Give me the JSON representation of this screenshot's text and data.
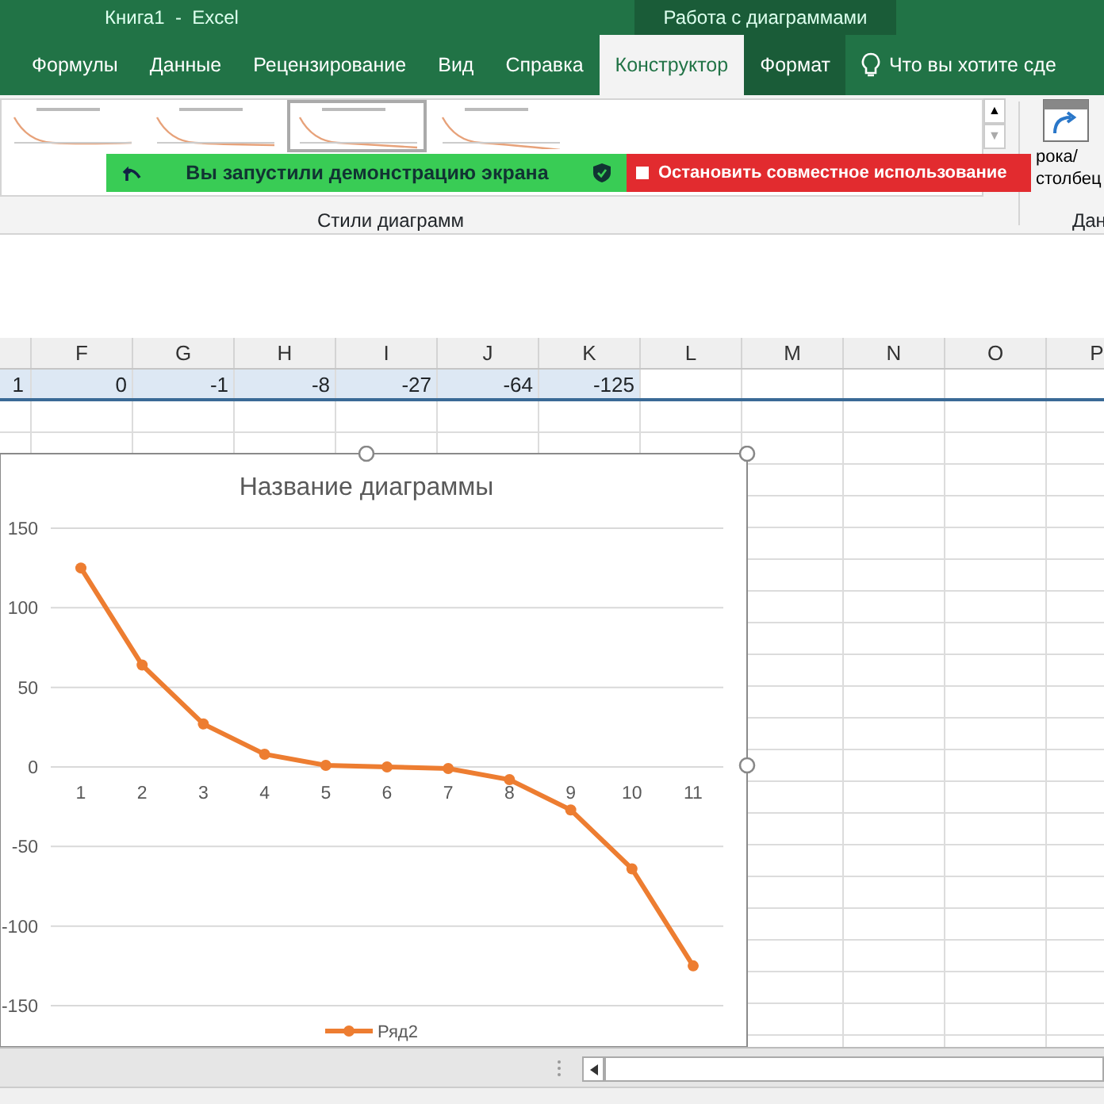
{
  "window": {
    "title": "Книга1  -  Excel",
    "context_title": "Работа с диаграммами"
  },
  "tabs": [
    {
      "label": "Формулы",
      "selected": false,
      "contextual": false
    },
    {
      "label": "Данные",
      "selected": false,
      "contextual": false
    },
    {
      "label": "Рецензирование",
      "selected": false,
      "contextual": false
    },
    {
      "label": "Вид",
      "selected": false,
      "contextual": false
    },
    {
      "label": "Справка",
      "selected": false,
      "contextual": false
    },
    {
      "label": "Конструктор",
      "selected": true,
      "contextual": true
    },
    {
      "label": "Формат",
      "selected": false,
      "contextual": true
    }
  ],
  "tell_me": {
    "placeholder": "Что вы хотите сде"
  },
  "ribbon": {
    "chart_styles": [
      {
        "selected": false
      },
      {
        "selected": false
      },
      {
        "selected": true
      },
      {
        "selected": false
      }
    ],
    "gallery_up": "▲",
    "gallery_down": "▼",
    "group_label": "Стили диаграмм",
    "switch_button_lines": [
      "рока/",
      "столбец"
    ],
    "data_group_label": "Дан"
  },
  "share_banner": {
    "status": "Вы запустили демонстрацию экрана",
    "stop": "Остановить совместное использование"
  },
  "sheet": {
    "columns": [
      "",
      "F",
      "G",
      "H",
      "I",
      "J",
      "K",
      "L",
      "M",
      "N",
      "O",
      "P"
    ],
    "rows": [
      {
        "selected": true,
        "cells": [
          "1",
          "0",
          "-1",
          "-8",
          "-27",
          "-64",
          "-125"
        ]
      }
    ]
  },
  "chart": {
    "chart_data": {
      "type": "line",
      "grid": true,
      "title": "Название диаграммы",
      "categories": [
        "1",
        "2",
        "3",
        "4",
        "5",
        "6",
        "7",
        "8",
        "9",
        "10",
        "11"
      ],
      "series": [
        {
          "name": "Ряд2",
          "color": "#ed7d31",
          "marker": true,
          "values": [
            125,
            64,
            27,
            8,
            1,
            0,
            -1,
            -8,
            -27,
            -64,
            -125
          ]
        }
      ],
      "ylim": [
        -150,
        150
      ],
      "yticks": [
        -150,
        -100,
        -50,
        0,
        50,
        100,
        150
      ]
    }
  }
}
